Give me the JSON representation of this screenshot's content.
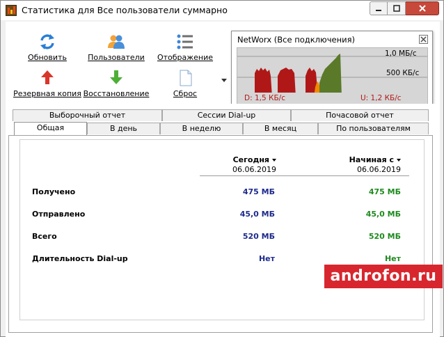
{
  "window": {
    "title": "Статистика для Все пользователи суммарно"
  },
  "toolbar": {
    "refresh_label": "Обновить",
    "users_label": "Пользователи",
    "display_label": "Отображение",
    "backup_label": "Резервная копия",
    "restore_label": "Восстановление",
    "reset_label": "Сброс"
  },
  "graph": {
    "title": "NetWorx (Все подключения)",
    "scale_top": "1,0 МБ/с",
    "scale_mid": "500 КБ/с",
    "download": "D: 1,5 КБ/с",
    "upload": "U: 1,2 КБ/с",
    "colors": {
      "download": "#b01818",
      "upload": "#5a7a2a",
      "overlap": "#f08a00",
      "background": "#d6d6d6"
    }
  },
  "tabs": {
    "row1": [
      {
        "label": "Выборочный отчет"
      },
      {
        "label": "Сессии Dial-up"
      },
      {
        "label": "Почасовой отчет"
      }
    ],
    "row2": [
      {
        "label": "Общая"
      },
      {
        "label": "В день"
      },
      {
        "label": "В неделю"
      },
      {
        "label": "В месяц"
      },
      {
        "label": "По пользователям"
      }
    ],
    "active": "Общая"
  },
  "stats": {
    "columns": [
      {
        "title": "Сегодня",
        "date": "06.06.2019"
      },
      {
        "title": "Начиная с",
        "date": "06.06.2019"
      }
    ],
    "rows": [
      {
        "label": "Получено",
        "today": "475 МБ",
        "since": "475 МБ"
      },
      {
        "label": "Отправлено",
        "today": "45,0 МБ",
        "since": "45,0 МБ"
      },
      {
        "label": "Всего",
        "today": "520 МБ",
        "since": "520 МБ"
      },
      {
        "label": "Длительность Dial-up",
        "today": "Нет",
        "since": "Нет"
      }
    ],
    "colors": {
      "today": "#1d2a8c",
      "since": "#1f8a1f"
    }
  },
  "watermark": {
    "text": "androfon.ru"
  }
}
